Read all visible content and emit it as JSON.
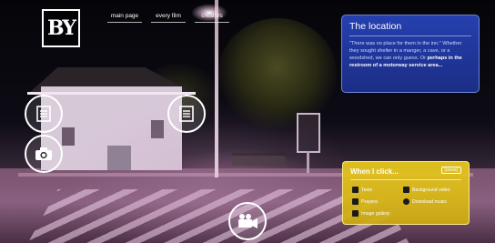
{
  "logo": {
    "text": "BY"
  },
  "nav": {
    "items": [
      "main page",
      "every film",
      "creators"
    ]
  },
  "location": {
    "title": "The location",
    "body": "\"There was no place for them in the inn.\" Whether they sought shelter in a manger, a cave, or a woodshed, we can only guess. Or",
    "body_bold": "perhaps in the restroom of a motorway service area..."
  },
  "legend": {
    "title": "When I click...",
    "close": "[close]",
    "items": {
      "texts": "Texts",
      "prayers": "Prayers",
      "gallery": "Image gallery",
      "video": "Background video",
      "music": "Download music"
    }
  },
  "colors": {
    "location_panel": "#2a46b8",
    "legend_panel": "#dcb81e"
  }
}
